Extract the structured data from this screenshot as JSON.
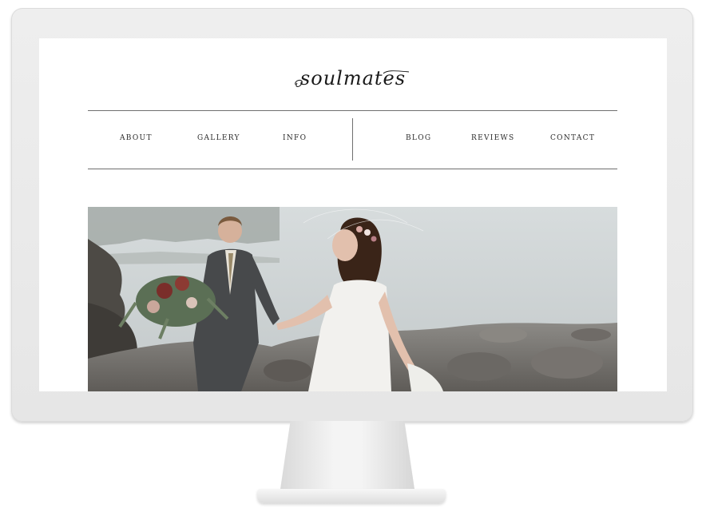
{
  "site": {
    "logo_text": "soulmates"
  },
  "nav": {
    "left": [
      "ABOUT",
      "GALLERY",
      "INFO"
    ],
    "right": [
      "BLOG",
      "REVIEWS",
      "CONTACT"
    ]
  },
  "colors": {
    "monitor": "#e8e8e8",
    "screen_bg": "#ffffff",
    "rule": "#6f6f6f",
    "nav_text": "#2b2b2b"
  },
  "hero": {
    "subject": "wedding couple holding hands on a rocky lakeshore"
  }
}
